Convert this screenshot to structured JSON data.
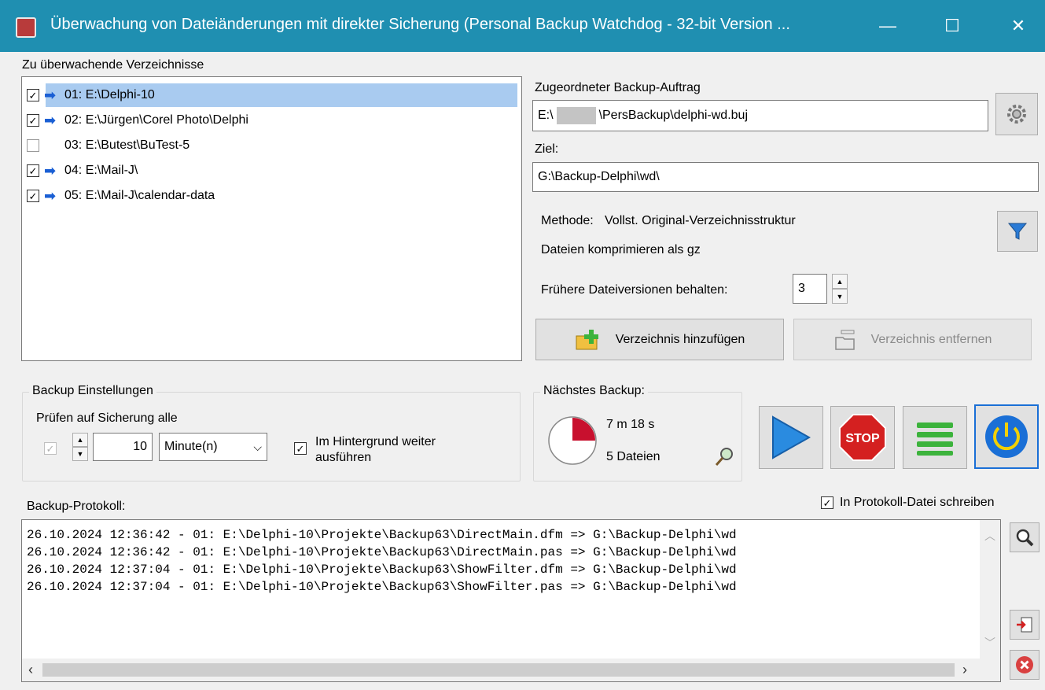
{
  "window": {
    "title": "Überwachung von Dateiänderungen mit direkter Sicherung (Personal Backup Watchdog - 32-bit Version ...",
    "minimize": "—",
    "maximize": "☐",
    "close": "✕"
  },
  "dirs": {
    "label": "Zu überwachende Verzeichnisse",
    "items": [
      {
        "checked": true,
        "active": true,
        "text": "01: E:\\Delphi-10"
      },
      {
        "checked": true,
        "active": true,
        "text": "02: E:\\Jürgen\\Corel Photo\\Delphi"
      },
      {
        "checked": false,
        "active": false,
        "text": "03: E:\\Butest\\BuTest-5"
      },
      {
        "checked": true,
        "active": true,
        "text": "04: E:\\Mail-J\\"
      },
      {
        "checked": true,
        "active": true,
        "text": "05: E:\\Mail-J\\calendar-data"
      }
    ]
  },
  "job": {
    "label": "Zugeordneter Backup-Auftrag",
    "prefix": "E:\\",
    "suffix": "\\PersBackup\\delphi-wd.buj",
    "target_label": "Ziel:",
    "target": "G:\\Backup-Delphi\\wd\\",
    "method_label": "Methode:",
    "method": "Vollst. Original-Verzeichnisstruktur",
    "compress": "Dateien komprimieren als gz",
    "versions_label": "Frühere Dateiversionen behalten:",
    "versions": "3",
    "add_button": "Verzeichnis hinzufügen",
    "remove_button": "Verzeichnis entfernen"
  },
  "settings": {
    "legend": "Backup Einstellungen",
    "check_label": "Prüfen auf Sicherung alle",
    "interval": "10",
    "unit": "Minute(n)",
    "background_line1": "Im Hintergrund weiter",
    "background_line2": "ausführen"
  },
  "next": {
    "legend": "Nächstes Backup:",
    "time": "7 m 18 s",
    "files": "5 Dateien",
    "progress_fraction": 0.25
  },
  "log": {
    "label": "Backup-Protokoll:",
    "write_file_label": "In Protokoll-Datei schreiben",
    "lines": [
      "26.10.2024 12:36:42 - 01: E:\\Delphi-10\\Projekte\\Backup63\\DirectMain.dfm => G:\\Backup-Delphi\\wd",
      "26.10.2024 12:36:42 - 01: E:\\Delphi-10\\Projekte\\Backup63\\DirectMain.pas => G:\\Backup-Delphi\\wd",
      "26.10.2024 12:37:04 - 01: E:\\Delphi-10\\Projekte\\Backup63\\ShowFilter.dfm => G:\\Backup-Delphi\\wd",
      "26.10.2024 12:37:04 - 01: E:\\Delphi-10\\Projekte\\Backup63\\ShowFilter.pas => G:\\Backup-Delphi\\wd"
    ]
  },
  "controls": {
    "stop_label": "STOP"
  },
  "colors": {
    "titlebar": "#1f8fb1",
    "selection": "#a9cbf0",
    "accent_blue": "#1a6fd6",
    "stop_red": "#d42020",
    "list_green": "#3cb33c"
  }
}
